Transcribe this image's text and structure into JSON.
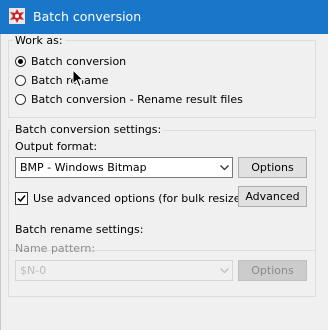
{
  "window": {
    "title": "Batch conversion",
    "icon": "irfanview-app-icon"
  },
  "work_as": {
    "legend": "Work as:",
    "options": [
      {
        "label": "Batch conversion",
        "checked": true
      },
      {
        "label": "Batch rename",
        "checked": false
      },
      {
        "label": "Batch conversion - Rename result files",
        "checked": false
      }
    ]
  },
  "conversion_settings": {
    "legend": "Batch conversion settings:",
    "output_format_label": "Output format:",
    "output_format_value": "BMP - Windows Bitmap",
    "options_button": "Options",
    "advanced_checkbox_label": "Use advanced options (for bulk resize...)",
    "advanced_checked": true,
    "advanced_button": "Advanced"
  },
  "rename_settings": {
    "legend": "Batch rename settings:",
    "name_pattern_label": "Name pattern:",
    "name_pattern_value": "$N-0",
    "options_button": "Options",
    "disabled": true
  },
  "colors": {
    "titlebar": "#1976c8",
    "window_bg": "#f0f0f0",
    "disabled_text": "#8c8c8c"
  }
}
